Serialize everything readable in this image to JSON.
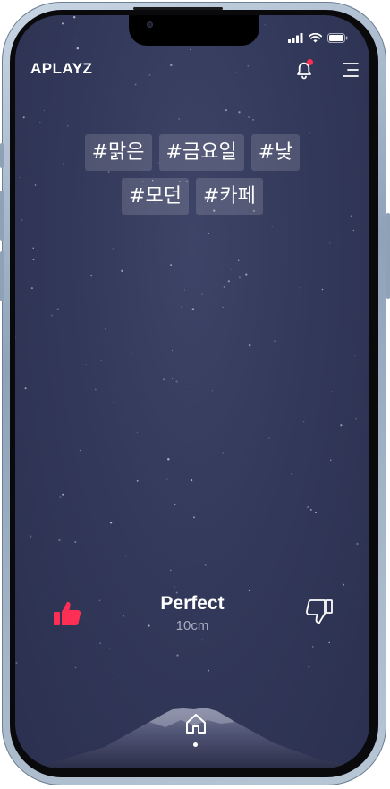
{
  "app": {
    "brand": "APLAYZ"
  },
  "header": {
    "notification_icon": "bell-icon",
    "notification_badge_color": "#ff2e55",
    "menu_icon": "menu-icon"
  },
  "tags": [
    [
      "#맑은",
      "#금요일",
      "#낮"
    ],
    [
      "#모던",
      "#카페"
    ]
  ],
  "player": {
    "title": "Perfect",
    "artist": "10cm",
    "like_icon": "thumbs-up-icon",
    "like_color": "#ff2e55",
    "dislike_icon": "thumbs-down-icon"
  },
  "nav": {
    "home_icon": "home-icon"
  },
  "status_bar": {
    "icons": [
      "signal-icon",
      "wifi-icon",
      "battery-icon"
    ]
  }
}
